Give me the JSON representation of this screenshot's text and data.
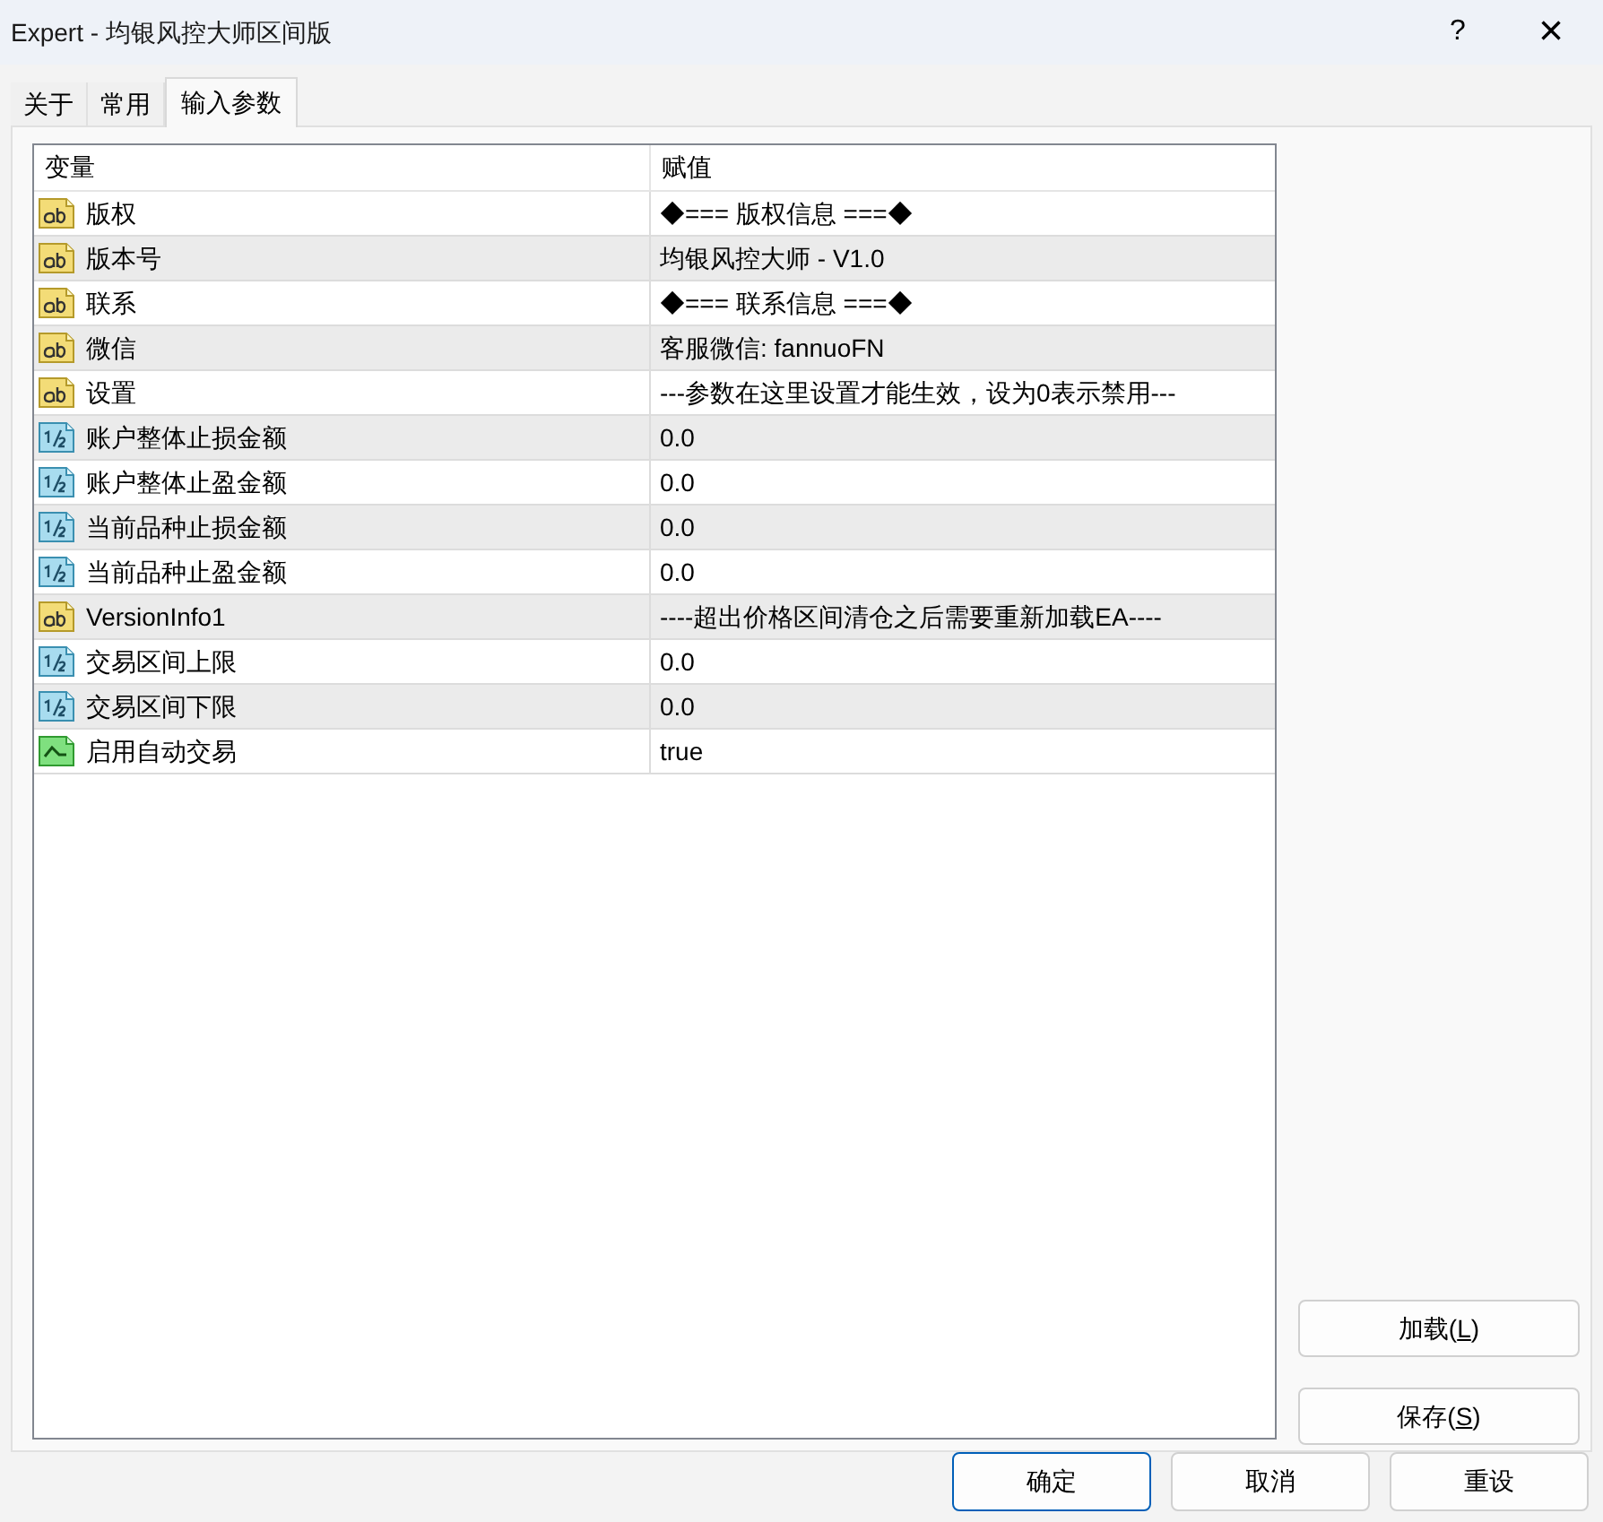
{
  "window": {
    "title": "Expert - 均银风控大师区间版",
    "help": "?",
    "close": "×"
  },
  "tabs": [
    {
      "label": "关于",
      "selected": false
    },
    {
      "label": "常用",
      "selected": false
    },
    {
      "label": "输入参数",
      "selected": true
    }
  ],
  "table": {
    "columns": [
      "变量",
      "赋值"
    ],
    "rows": [
      {
        "kind": "text",
        "name": "版权",
        "value": "◆=== 版权信息 ===◆"
      },
      {
        "kind": "text",
        "name": "版本号",
        "value": "均银风控大师 - V1.0"
      },
      {
        "kind": "text",
        "name": "联系",
        "value": "◆=== 联系信息 ===◆"
      },
      {
        "kind": "text",
        "name": "微信",
        "value": "客服微信: fannuoFN"
      },
      {
        "kind": "text",
        "name": "设置",
        "value": "---参数在这里设置才能生效，设为0表示禁用---"
      },
      {
        "kind": "number",
        "name": "账户整体止损金额",
        "value": "0.0"
      },
      {
        "kind": "number",
        "name": "账户整体止盈金额",
        "value": "0.0"
      },
      {
        "kind": "number",
        "name": "当前品种止损金额",
        "value": "0.0"
      },
      {
        "kind": "number",
        "name": "当前品种止盈金额",
        "value": "0.0"
      },
      {
        "kind": "text",
        "name": "VersionInfo1",
        "value": "----超出价格区间清仓之后需要重新加载EA----"
      },
      {
        "kind": "number",
        "name": "交易区间上限",
        "value": "0.0"
      },
      {
        "kind": "number",
        "name": "交易区间下限",
        "value": "0.0"
      },
      {
        "kind": "bool",
        "name": "启用自动交易",
        "value": "true"
      }
    ]
  },
  "side_buttons": [
    {
      "before": "加载(",
      "mnemonic": "L",
      "after": ")"
    },
    {
      "before": "保存(",
      "mnemonic": "S",
      "after": ")"
    }
  ],
  "footer_buttons": [
    {
      "label": "确定",
      "default": true
    },
    {
      "label": "取消",
      "default": false
    },
    {
      "label": "重设",
      "default": false
    }
  ]
}
